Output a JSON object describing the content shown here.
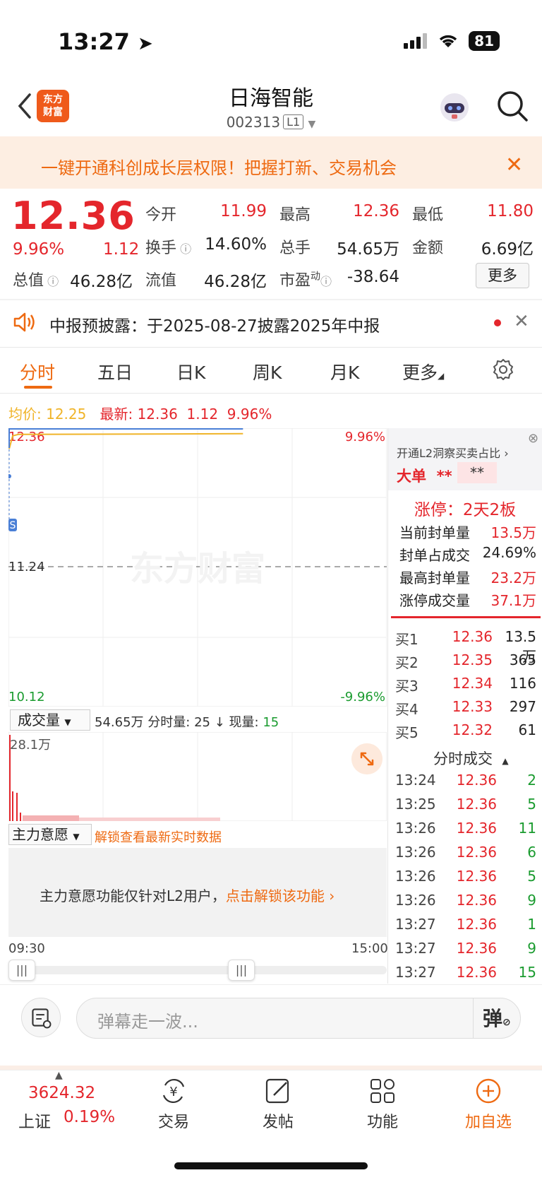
{
  "status_bar": {
    "time": "13:27",
    "battery": "81"
  },
  "header": {
    "title": "日海智能",
    "code": "002313",
    "level_badge": "L1",
    "logo_line1": "东方",
    "logo_line2": "财富"
  },
  "banner": {
    "text": "一键开通科创成长层权限！把握打新、交易机会"
  },
  "quote": {
    "price": "12.36",
    "change_pct": "9.96%",
    "change": "1.12",
    "open_label": "今开",
    "open": "11.99",
    "high_label": "最高",
    "high": "12.36",
    "low_label": "最低",
    "low": "11.80",
    "turnover_label": "换手",
    "turnover": "14.60%",
    "volume_label": "总手",
    "volume": "54.65万",
    "amount_label": "金额",
    "amount": "6.69亿",
    "mktcap_label": "总值",
    "mktcap": "46.28亿",
    "float_label": "流值",
    "float_cap": "46.28亿",
    "pe_label": "市盈",
    "pe_sup": "动",
    "pe": "-38.64",
    "more_label": "更多"
  },
  "notice": {
    "text": "中报预披露：于2025-08-27披露2025年中报"
  },
  "tabs": [
    "分时",
    "五日",
    "日K",
    "周K",
    "月K",
    "更多"
  ],
  "avg_line": {
    "avg_label": "均价:",
    "avg": "12.25",
    "latest_label": "最新:",
    "latest": "12.36",
    "chg": "1.12",
    "pct": "9.96%"
  },
  "chart": {
    "y_top": "12.36",
    "y_mid": "11.24",
    "y_bottom": "10.12",
    "pct_top": "9.96%",
    "pct_bottom": "-9.96%",
    "watermark": "东方财富",
    "s_marker": "S",
    "volume_selector": "成交量",
    "volume_info_total": "54.65万",
    "volume_info_min_label": "分时量:",
    "volume_info_min": "25",
    "volume_info_now_label": "现量:",
    "volume_info_now": "15",
    "volume_max": "28.1万",
    "mf_selector": "主力意愿",
    "mf_unlock": "解锁查看最新实时数据",
    "mf_text": "主力意愿功能仅针对L2用户，",
    "mf_link": "点击解锁该功能",
    "time_start": "09:30",
    "time_end": "15:00",
    "price_line": {
      "start": 12.2,
      "flat": 12.31,
      "end_fraction": 0.62
    },
    "colors": {
      "price": "#4a7fd6",
      "avg": "#f0b429",
      "volume": "#e4262c"
    }
  },
  "right_panel": {
    "promo": "开通L2洞察买卖占比",
    "big_order_label": "大单",
    "big_order_val": "**",
    "big_order_box": "**",
    "limit_title": "涨停：2天2板",
    "seal_rows": [
      {
        "label": "当前封单量",
        "value": "13.5万"
      },
      {
        "label": "封单占成交",
        "value": "24.69%"
      },
      {
        "label": "最高封单量",
        "value": "23.2万"
      },
      {
        "label": "涨停成交量",
        "value": "37.1万"
      }
    ],
    "book": [
      {
        "label": "买1",
        "price": "12.36",
        "vol": "13.5万"
      },
      {
        "label": "买2",
        "price": "12.35",
        "vol": "365"
      },
      {
        "label": "买3",
        "price": "12.34",
        "vol": "116"
      },
      {
        "label": "买4",
        "price": "12.33",
        "vol": "297"
      },
      {
        "label": "买5",
        "price": "12.32",
        "vol": "61"
      }
    ],
    "trades_title": "分时成交",
    "trades": [
      {
        "time": "13:24",
        "price": "12.36",
        "vol": "2"
      },
      {
        "time": "13:25",
        "price": "12.36",
        "vol": "5"
      },
      {
        "time": "13:26",
        "price": "12.36",
        "vol": "11"
      },
      {
        "time": "13:26",
        "price": "12.36",
        "vol": "6"
      },
      {
        "time": "13:26",
        "price": "12.36",
        "vol": "5"
      },
      {
        "time": "13:26",
        "price": "12.36",
        "vol": "9"
      },
      {
        "time": "13:27",
        "price": "12.36",
        "vol": "1"
      },
      {
        "time": "13:27",
        "price": "12.36",
        "vol": "9"
      },
      {
        "time": "13:27",
        "price": "12.36",
        "vol": "15"
      }
    ]
  },
  "comment": {
    "placeholder": "弹幕走一波...",
    "danmu": "弹"
  },
  "bottom_nav": {
    "index_value": "3624.32",
    "index_name": "上证",
    "index_pct": "0.19%",
    "items": [
      {
        "label": "交易"
      },
      {
        "label": "发帖"
      },
      {
        "label": "功能"
      },
      {
        "label": "加自选"
      }
    ]
  }
}
